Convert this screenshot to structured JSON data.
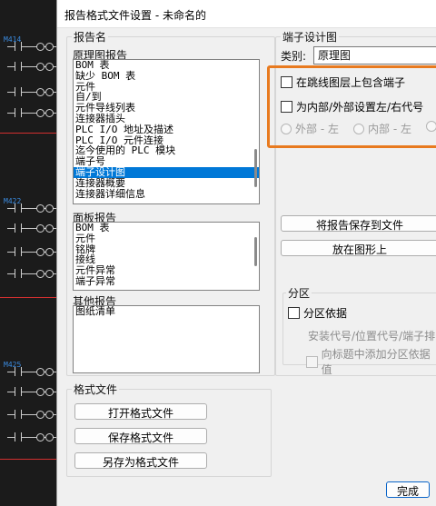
{
  "cad_tags": [
    "M414",
    "M422",
    "M425"
  ],
  "dialog": {
    "title": "报告格式文件设置 - 未命名的"
  },
  "report_name": {
    "group_label": "报告名",
    "schematic_label": "原理图报告",
    "schematic_items": [
      "BOM 表",
      "缺少 BOM 表",
      "元件",
      "自/到",
      "元件导线列表",
      "连接器插头",
      "PLC I/O 地址及描述",
      "PLC I/O 元件连接",
      "迄今使用的 PLC 模块",
      "端子号",
      "端子设计图",
      "连接器概要",
      "连接器详细信息"
    ],
    "schematic_selected_index": 10,
    "panel_label": "面板报告",
    "panel_items": [
      "BOM 表",
      "元件",
      "铭牌",
      "接线",
      "元件异常",
      "端子异常"
    ],
    "other_label": "其他报告",
    "other_items": [
      "图纸清单"
    ]
  },
  "format_file": {
    "group_label": "格式文件",
    "open_button": "打开格式文件",
    "save_button": "保存格式文件",
    "save_as_button": "另存为格式文件"
  },
  "terminal": {
    "group_label": "端子设计图",
    "category_label": "类别:",
    "category_value": "原理图",
    "include_jumper_label": "在跳线图层上包含端子",
    "set_lr_label": "为内部/外部设置左/右代号",
    "radio_options": [
      "外部 - 左",
      "内部 - 左"
    ],
    "save_report_button": "将报告保存到文件",
    "place_on_drawing_button": "放在图形上"
  },
  "zone": {
    "group_label": "分区",
    "zone_basis_label": "分区依据",
    "zone_basis_value": "安装代号/位置代号/端子排",
    "add_title_label": "向标题中添加分区依据值"
  },
  "footer": {
    "done_button": "完成"
  }
}
